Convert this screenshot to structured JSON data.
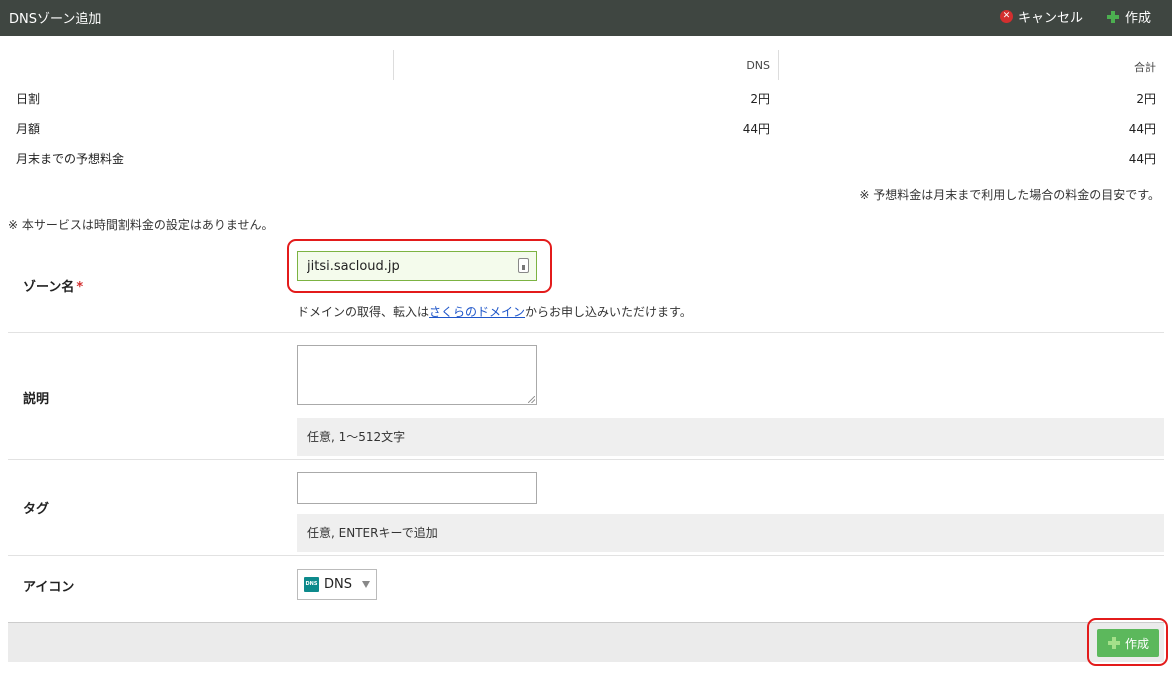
{
  "header": {
    "title": "DNSゾーン追加",
    "cancel_label": "キャンセル",
    "create_label": "作成"
  },
  "pricing": {
    "columns": [
      "DNS",
      "合計"
    ],
    "rows": [
      {
        "label": "日割",
        "dns": "2円",
        "total": "2円"
      },
      {
        "label": "月額",
        "dns": "44円",
        "total": "44円"
      },
      {
        "label": "月末までの予想料金",
        "dns": "",
        "total": "44円"
      }
    ],
    "estimate_note": "※ 予想料金は月末まで利用した場合の料金の目安です。",
    "hourly_note": "※ 本サービスは時間割料金の設定はありません。"
  },
  "form": {
    "zone": {
      "label": "ゾーン名",
      "required_mark": "*",
      "value": "jitsi.sacloud.jp",
      "help_prefix": "ドメインの取得、転入は",
      "help_link": "さくらのドメイン",
      "help_suffix": "からお申し込みいただけます。"
    },
    "description": {
      "label": "説明",
      "value": "",
      "hint": "任意, 1〜512文字"
    },
    "tag": {
      "label": "タグ",
      "value": "",
      "hint": "任意, ENTERキーで追加"
    },
    "icon": {
      "label": "アイコン",
      "selected": "DNS",
      "badge_text": "DNS"
    }
  },
  "footer": {
    "create_label": "作成"
  },
  "colors": {
    "topbar": "#3f4641",
    "create_button": "#5cb85c",
    "highlight": "#e31b1b",
    "link": "#1f56c9"
  }
}
